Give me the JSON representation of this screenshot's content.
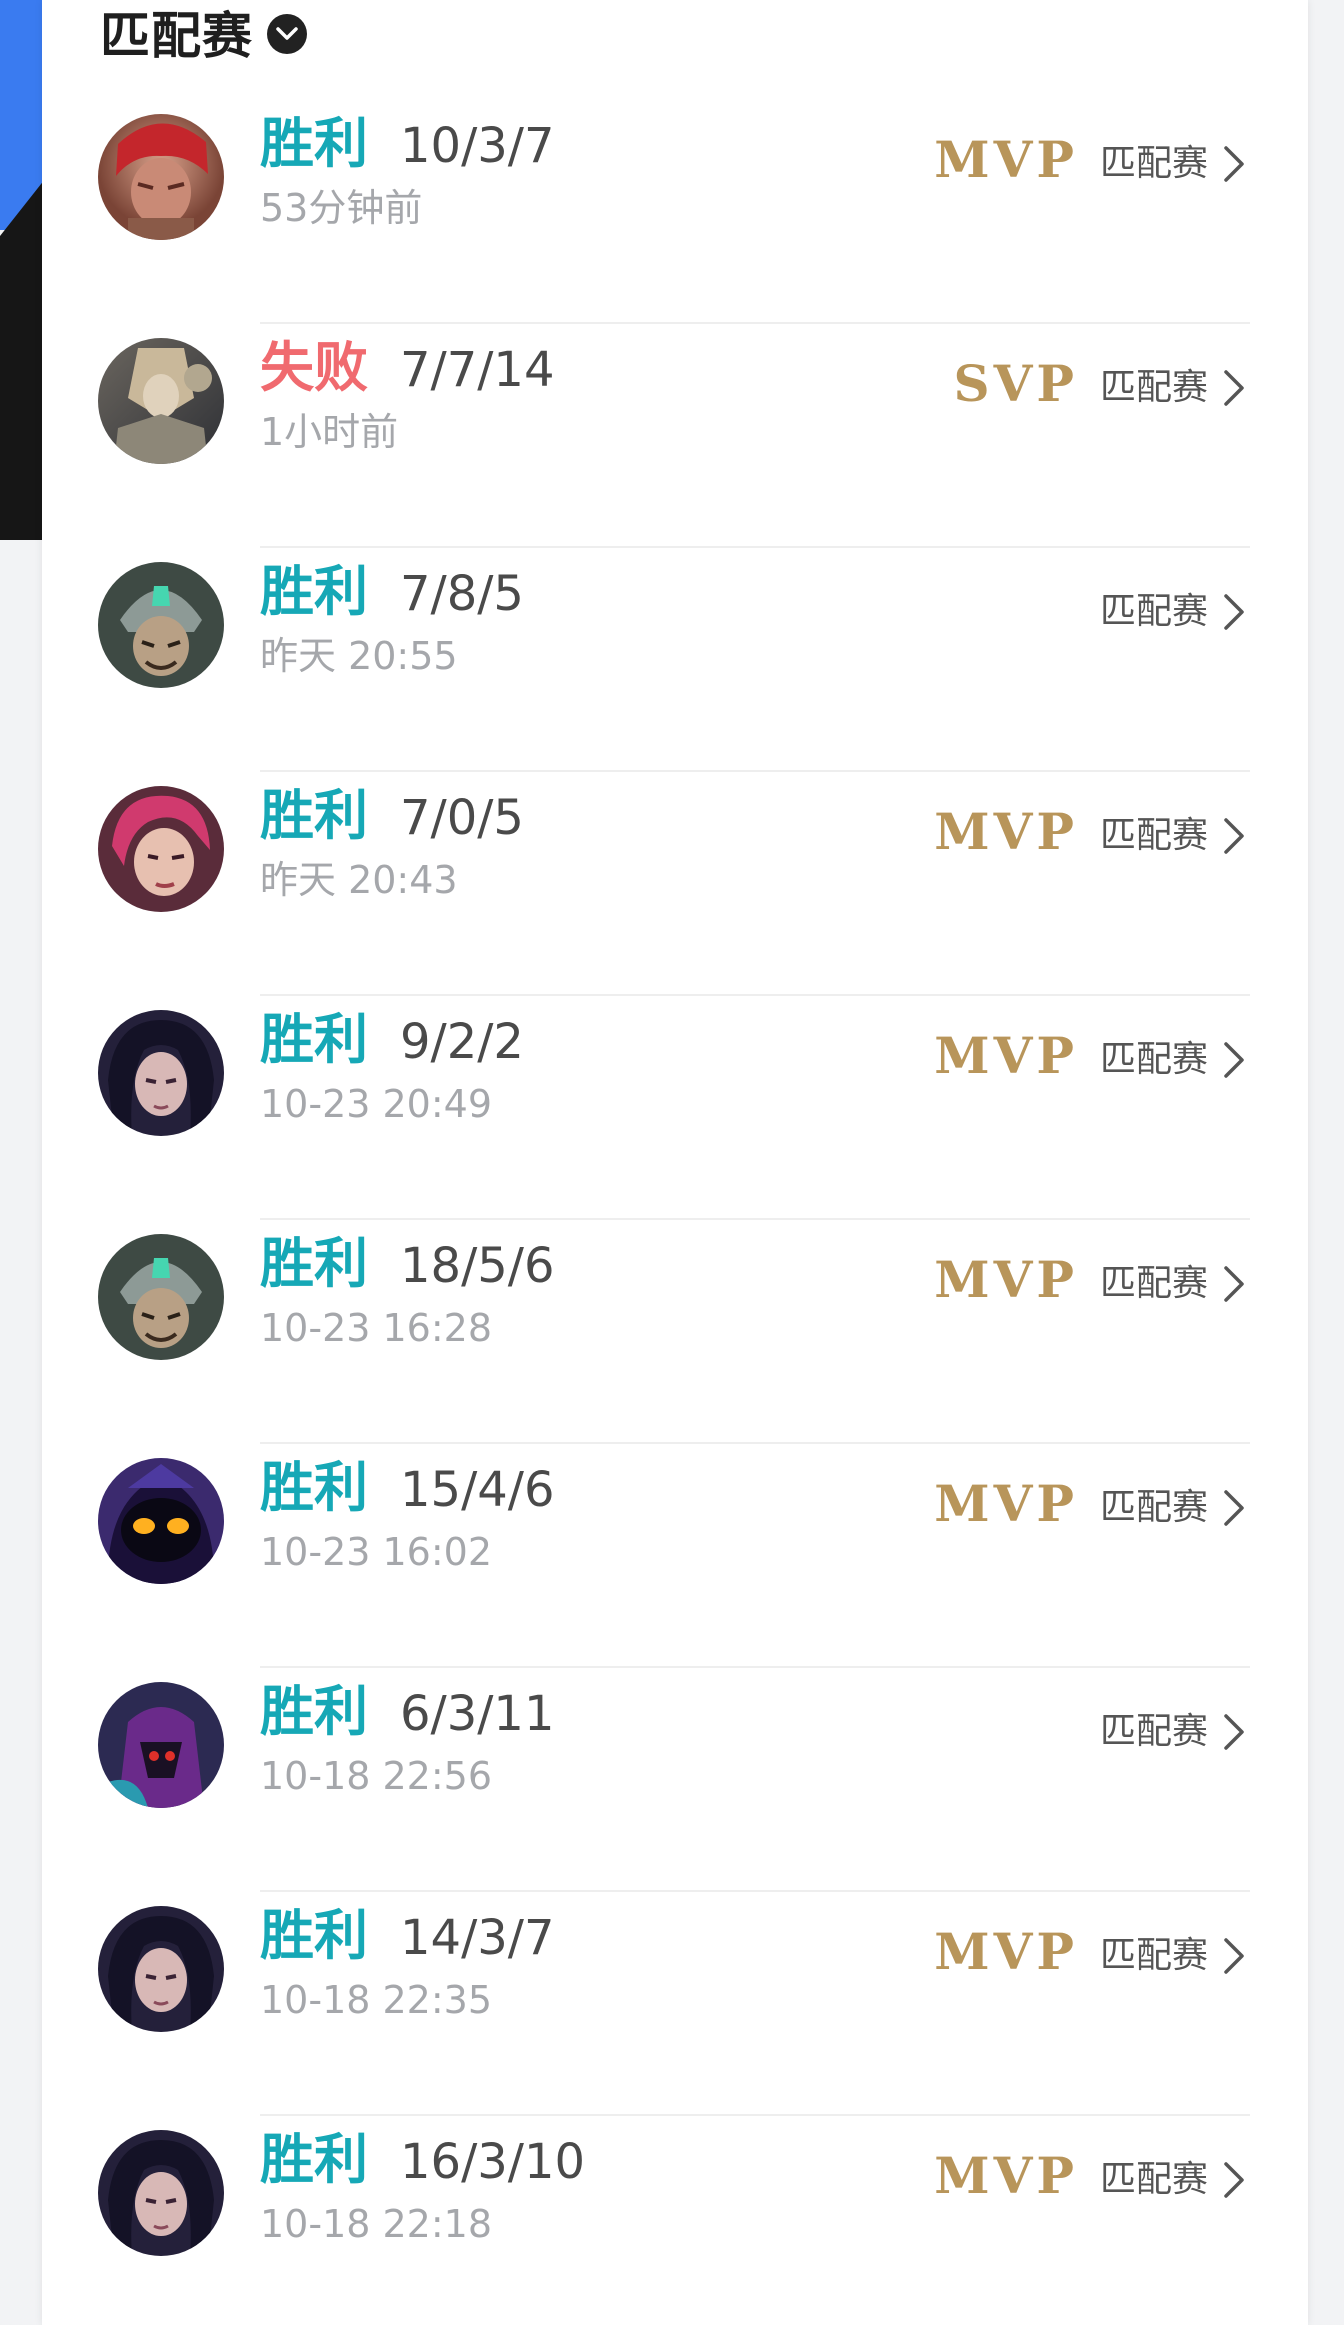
{
  "header": {
    "title": "匹配赛"
  },
  "matches": [
    {
      "result": "胜利",
      "kind": "win",
      "kda": "10/3/7",
      "time": "53分钟前",
      "badge": "MVP",
      "mode": "匹配赛",
      "avatar": "red-hair-champion-avatar"
    },
    {
      "result": "失败",
      "kind": "loss",
      "kda": "7/7/14",
      "time": "1小时前",
      "badge": "SVP",
      "mode": "匹配赛",
      "avatar": "armored-champion-avatar"
    },
    {
      "result": "胜利",
      "kind": "win",
      "kda": "7/8/5",
      "time": "昨天 20:55",
      "badge": "",
      "mode": "匹配赛",
      "avatar": "helmet-champion-avatar"
    },
    {
      "result": "胜利",
      "kind": "win",
      "kda": "7/0/5",
      "time": "昨天 20:43",
      "badge": "MVP",
      "mode": "匹配赛",
      "avatar": "pink-hair-champion-avatar"
    },
    {
      "result": "胜利",
      "kind": "win",
      "kda": "9/2/2",
      "time": "10-23 20:49",
      "badge": "MVP",
      "mode": "匹配赛",
      "avatar": "dark-hair-champion-avatar"
    },
    {
      "result": "胜利",
      "kind": "win",
      "kda": "18/5/6",
      "time": "10-23 16:28",
      "badge": "MVP",
      "mode": "匹配赛",
      "avatar": "helmet-champion-avatar"
    },
    {
      "result": "胜利",
      "kind": "win",
      "kda": "15/4/6",
      "time": "10-23 16:02",
      "badge": "MVP",
      "mode": "匹配赛",
      "avatar": "hooded-yellow-eyes-avatar"
    },
    {
      "result": "胜利",
      "kind": "win",
      "kda": "6/3/11",
      "time": "10-18 22:56",
      "badge": "",
      "mode": "匹配赛",
      "avatar": "purple-assassin-avatar"
    },
    {
      "result": "胜利",
      "kind": "win",
      "kda": "14/3/7",
      "time": "10-18 22:35",
      "badge": "MVP",
      "mode": "匹配赛",
      "avatar": "dark-hair-champion-avatar"
    },
    {
      "result": "胜利",
      "kind": "win",
      "kda": "16/3/10",
      "time": "10-18 22:18",
      "badge": "MVP",
      "mode": "匹配赛",
      "avatar": "dark-hair-champion-avatar"
    }
  ],
  "colors": {
    "win": "#16a8b6",
    "loss": "#f06a6f",
    "badge_gold": "#b8955a"
  }
}
